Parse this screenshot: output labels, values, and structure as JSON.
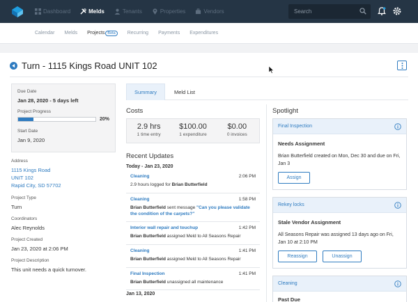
{
  "topbar": {
    "nav": [
      {
        "label": "Dashboard",
        "icon": "dashboard-icon"
      },
      {
        "label": "Melds",
        "icon": "tools-icon",
        "active": true
      },
      {
        "label": "Tenants",
        "icon": "tenants-icon"
      },
      {
        "label": "Properties",
        "icon": "location-pin-icon"
      },
      {
        "label": "Vendors",
        "icon": "vendors-icon"
      }
    ],
    "search_placeholder": "Search"
  },
  "subnav": {
    "items": [
      "Calendar",
      "Melds",
      "Projects",
      "Recurring",
      "Payments",
      "Expenditures"
    ],
    "beta": "Beta"
  },
  "page": {
    "title": "Turn - 1115 Kings Road UNIT 102"
  },
  "summary": {
    "due_label": "Due Date",
    "due_value": "Jan 28, 2020 - 5 days left",
    "progress_label": "Project Progress",
    "progress_pct_text": "20%",
    "progress_value": 20,
    "start_label": "Start Date",
    "start_value": "Jan 9, 2020"
  },
  "details": {
    "address_label": "Address",
    "address_lines": [
      "1115 Kings Road",
      "UNIT 102",
      "Rapid City, SD 57702"
    ],
    "type_label": "Project Type",
    "type_value": "Turn",
    "coord_label": "Coordinators",
    "coord_value": "Alec Reynolds",
    "created_label": "Project Created",
    "created_value": "Jan 23, 2020 at 2:06 PM",
    "desc_label": "Project Description",
    "desc_value": "This unit needs a quick turnover."
  },
  "tabs": [
    "Summary",
    "Meld List"
  ],
  "costs": {
    "title": "Costs",
    "items": [
      {
        "value": "2.9 hrs",
        "sub": "1 time entry"
      },
      {
        "value": "$100.00",
        "sub": "1 expenditure"
      },
      {
        "value": "$0.00",
        "sub": "0 invoices"
      }
    ]
  },
  "updates": {
    "title": "Recent Updates",
    "day1": "Today - Jan 23, 2020",
    "day2": "Jan 13, 2020",
    "items": [
      {
        "title": "Cleaning",
        "time": "2:06 PM",
        "text": "2.9 hours logged for ",
        "who": "Brian Butterfield"
      },
      {
        "title": "Cleaning",
        "time": "1:58 PM",
        "who": "Brian Butterfield",
        "text": " sent message ",
        "quote": "\"Can you please validate the condition of the carpets?\""
      },
      {
        "title": "Interior wall repair and touchup",
        "time": "1:42 PM",
        "who": "Brian Butterfield",
        "text": " assigned Meld to All Seasons Repair"
      },
      {
        "title": "Cleaning",
        "time": "1:41 PM",
        "who": "Brian Butterfield",
        "text": " assigned Meld to All Seasons Repair"
      },
      {
        "title": "Final Inspection",
        "time": "1:41 PM",
        "who": "Brian Butterfield",
        "text": " unassigned all maintenance"
      }
    ]
  },
  "spotlight": {
    "title": "Spotlight",
    "cards": [
      {
        "head": "Final Inspection",
        "sub": "Needs Assignment",
        "text": "Brian Butterfield created on Mon, Dec 30 and due on Fri, Jan 3",
        "buttons": [
          "Assign"
        ]
      },
      {
        "head": "Rekey locks",
        "sub": "Stale Vendor Assignment",
        "text": "All Seasons Repair was assigned 13 days ago on Fri, Jan 10 at 2:10 PM",
        "buttons": [
          "Reassign",
          "Unassign"
        ]
      },
      {
        "head": "Cleaning",
        "sub": "Past Due"
      }
    ]
  },
  "colors": {
    "topbar": "#253545",
    "accent": "#2e7bc0",
    "panel": "#f4f4f5"
  }
}
